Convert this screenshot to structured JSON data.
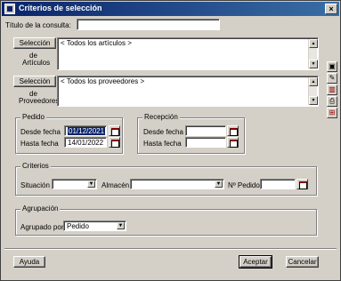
{
  "window": {
    "title": "Criterios de selección",
    "close_glyph": "×"
  },
  "consulta": {
    "label": "Título de la consulta:",
    "value": ""
  },
  "articulos": {
    "button_label": "Selección",
    "caption_line1": "de",
    "caption_line2": "Artículos",
    "value": "< Todos los artículos >"
  },
  "proveedores": {
    "button_label": "Selección",
    "caption_line1": "de",
    "caption_line2": "Proveedores",
    "value": "< Todos los proveedores >"
  },
  "pedido": {
    "group_label": "Pedido",
    "desde_label": "Desde fecha",
    "desde_value": "01/12/2021",
    "hasta_label": "Hasta fecha",
    "hasta_value": "14/01/2022"
  },
  "recepcion": {
    "group_label": "Recepción",
    "desde_label": "Desde fecha",
    "desde_value": "",
    "hasta_label": "Hasta fecha",
    "hasta_value": ""
  },
  "criterios": {
    "group_label": "Criterios",
    "situacion_label": "Situación",
    "situacion_value": "",
    "almacen_label": "Almacén",
    "almacen_value": "",
    "npedido_label": "Nº Pedido",
    "npedido_value": ""
  },
  "agrupacion": {
    "group_label": "Agrupación",
    "label": "Agrupado por",
    "value": "Pedido"
  },
  "footer": {
    "ayuda": "Ayuda",
    "aceptar": "Aceptar",
    "cancelar": "Cancelar"
  },
  "side_icons": [
    "save-icon",
    "edit-icon",
    "delete-icon",
    "print-icon",
    "filter-icon"
  ]
}
